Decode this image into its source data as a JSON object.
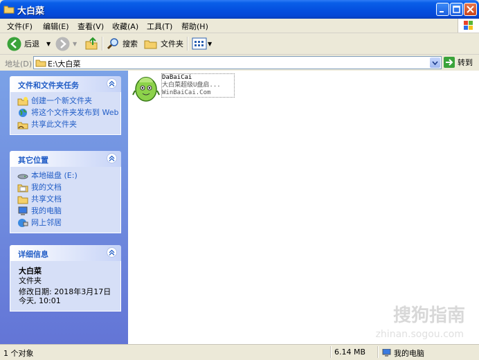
{
  "window": {
    "title": "大白菜"
  },
  "menu": [
    "文件(F)",
    "编辑(E)",
    "查看(V)",
    "收藏(A)",
    "工具(T)",
    "帮助(H)"
  ],
  "toolbar": {
    "back": "后退",
    "search": "搜索",
    "folders": "文件夹"
  },
  "address": {
    "label": "地址(D)",
    "value": "E:\\大白菜",
    "go": "转到"
  },
  "tasks": {
    "title": "文件和文件夹任务",
    "items": [
      "创建一个新文件夹",
      "将这个文件夹发布到 Web",
      "共享此文件夹"
    ]
  },
  "places": {
    "title": "其它位置",
    "items": [
      "本地磁盘 (E:)",
      "我的文档",
      "共享文档",
      "我的电脑",
      "网上邻居"
    ]
  },
  "details": {
    "title": "详细信息",
    "name": "大白菜",
    "type": "文件夹",
    "modified_label": "修改日期: 2018年3月17日",
    "modified_time": "今天, 10:01"
  },
  "file": {
    "line1": "DaBaiCai",
    "line2": "大白菜超级U盘启...",
    "line3": "WinBaiCai.Com"
  },
  "watermark": {
    "main": "搜狗指南",
    "sub": "zhinan.sogou.com"
  },
  "status": {
    "count": "1 个对象",
    "size": "6.14 MB",
    "location": "我的电脑"
  }
}
